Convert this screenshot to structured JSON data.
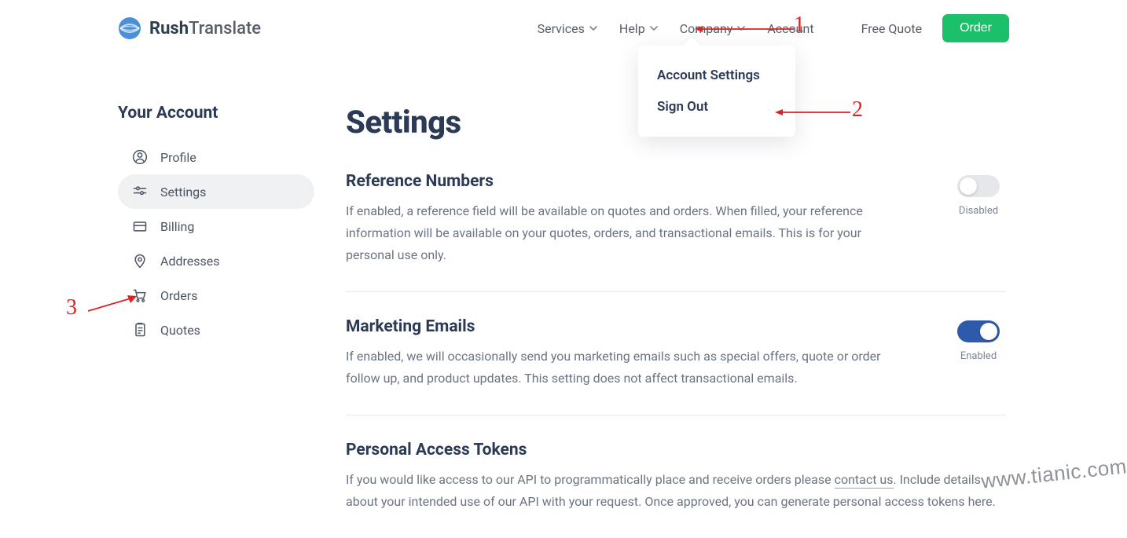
{
  "header": {
    "logo_bold": "Rush",
    "logo_light": "Translate",
    "nav": {
      "services": "Services",
      "help": "Help",
      "company": "Company",
      "account": "Account"
    },
    "free_quote": "Free Quote",
    "order": "Order"
  },
  "dropdown": {
    "account_settings": "Account Settings",
    "sign_out": "Sign Out"
  },
  "sidebar": {
    "title": "Your Account",
    "items": {
      "profile": "Profile",
      "settings": "Settings",
      "billing": "Billing",
      "addresses": "Addresses",
      "orders": "Orders",
      "quotes": "Quotes"
    }
  },
  "page": {
    "title": "Settings",
    "sections": {
      "reference": {
        "title": "Reference Numbers",
        "desc": "If enabled, a reference field will be available on quotes and orders. When filled, your reference information will be available on your quotes, orders, and transactional emails. This is for your personal use only.",
        "toggle_label": "Disabled"
      },
      "marketing": {
        "title": "Marketing Emails",
        "desc": "If enabled, we will occasionally send you marketing emails such as special offers, quote or order follow up, and product updates. This setting does not affect transactional emails.",
        "toggle_label": "Enabled"
      },
      "tokens": {
        "title": "Personal Access Tokens",
        "desc_pre": "If you would like access to our API to programmatically place and receive orders please ",
        "link": "contact us",
        "desc_post": ". Include details about your intended use of our API with your request. Once approved, you can generate personal access tokens here."
      }
    }
  },
  "annotations": {
    "a1": "1",
    "a2": "2",
    "a3": "3"
  },
  "watermark": "www.tianic.com"
}
